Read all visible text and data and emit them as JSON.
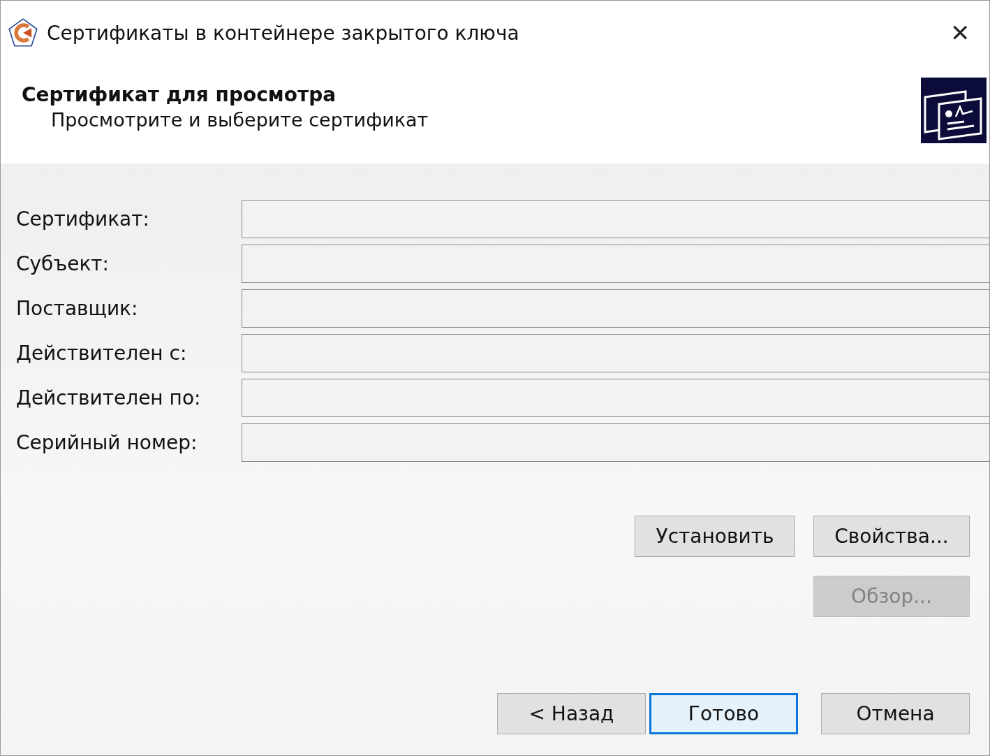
{
  "window": {
    "title": "Сертификаты в контейнере закрытого ключа",
    "close": "✕"
  },
  "header": {
    "title": "Сертификат для просмотра",
    "subtitle": "Просмотрите и выберите сертификат"
  },
  "fields": [
    {
      "label": "Сертификат:"
    },
    {
      "label": "Субъект:"
    },
    {
      "label": "Поставщик:"
    },
    {
      "label": "Действителен с:"
    },
    {
      "label": "Действителен по:"
    },
    {
      "label": "Серийный номер:"
    }
  ],
  "actions": [
    {
      "label": "Установить",
      "disabled": false
    },
    {
      "label": "Свойства...",
      "disabled": false
    },
    {
      "label": "Обзор...",
      "disabled": true
    }
  ],
  "footer_buttons": [
    {
      "label": "< Назад",
      "default": false
    },
    {
      "label": "Готово",
      "default": true
    },
    {
      "label": "Отмена",
      "default": false
    }
  ]
}
